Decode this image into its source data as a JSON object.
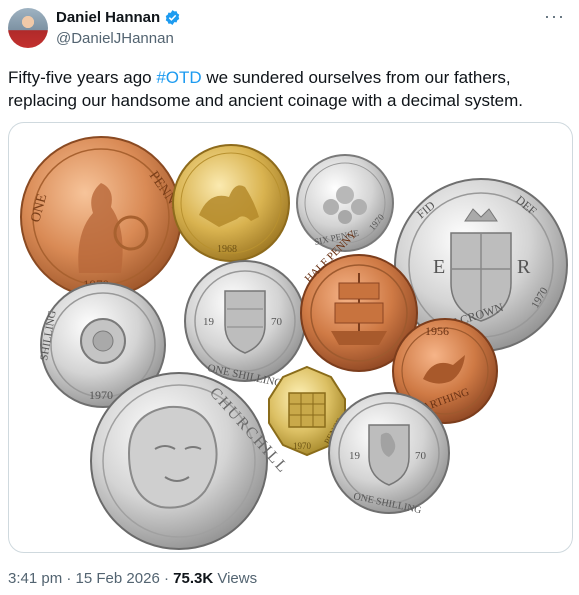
{
  "author": {
    "display_name": "Daniel Hannan",
    "handle": "@DanielJHannan",
    "verified": true
  },
  "more_label": "···",
  "tweet": {
    "text_before": "Fifty-five years ago ",
    "hashtag": "#OTD",
    "text_after": " we sundered ourselves from our fathers, replacing our handsome and ancient coinage with a decimal system."
  },
  "media": {
    "coin_labels": {
      "penny_left": "ONE",
      "penny_right": "PENNY",
      "penny_year": "1970",
      "sovereign_year": "1968",
      "sixpence_text": "SIX PENCE",
      "sixpence_year": "1970",
      "halfcrown_left": "FID",
      "halfcrown_right": "DEF",
      "halfcrown_bottom": "HALF CROWN",
      "halfcrown_year": "1970",
      "halfcrown_e": "E",
      "halfcrown_r": "R",
      "shilling_left_text": "SHILLING",
      "shilling_left_year": "1970",
      "shilling_mid_text": "ONE SHILLING",
      "shilling_mid_y1": "19",
      "shilling_mid_y2": "70",
      "halfpenny_text": "HALF PENNY",
      "threepence_text": "PENCE",
      "threepence_year": "1970",
      "farthing_year": "1956",
      "farthing_text": "FARTHING",
      "crown_text": "CHURCHILL",
      "shilling_right_text": "ONE SHILLING",
      "shilling_right_y1": "19",
      "shilling_right_y2": "70"
    }
  },
  "meta": {
    "time": "3:41 pm",
    "date": "15 Feb 2026",
    "separator": "·",
    "views_count": "75.3K",
    "views_label": "Views"
  },
  "colors": {
    "link": "#1d9bf0",
    "secondary": "#536471",
    "verified": "#1d9bf0"
  }
}
